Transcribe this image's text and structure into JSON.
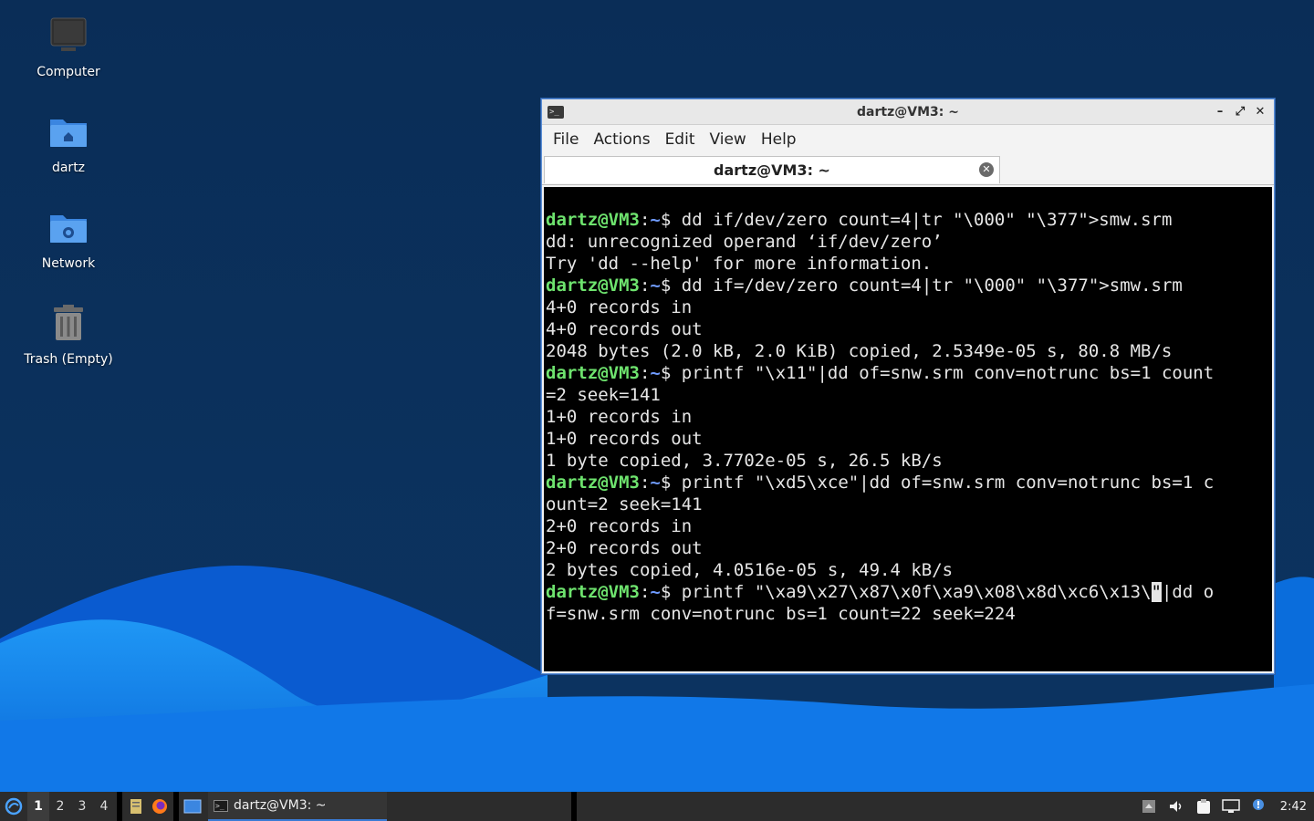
{
  "desktop": {
    "icons": [
      {
        "label": "Computer"
      },
      {
        "label": "dartz"
      },
      {
        "label": "Network"
      },
      {
        "label": "Trash (Empty)"
      }
    ]
  },
  "terminal": {
    "title": "dartz@VM3: ~",
    "menu": [
      "File",
      "Actions",
      "Edit",
      "View",
      "Help"
    ],
    "tab_label": "dartz@VM3: ~",
    "prompt_user": "dartz@VM3",
    "prompt_path": "~",
    "lines": [
      {
        "type": "cmd",
        "text": " dd if/dev/zero count=4|tr \"\\000\" \"\\377\">smw.srm"
      },
      {
        "type": "out",
        "text": "dd: unrecognized operand ‘if/dev/zero’"
      },
      {
        "type": "out",
        "text": "Try 'dd --help' for more information."
      },
      {
        "type": "cmd",
        "text": " dd if=/dev/zero count=4|tr \"\\000\" \"\\377\">smw.srm"
      },
      {
        "type": "out",
        "text": "4+0 records in"
      },
      {
        "type": "out",
        "text": "4+0 records out"
      },
      {
        "type": "out",
        "text": "2048 bytes (2.0 kB, 2.0 KiB) copied, 2.5349e-05 s, 80.8 MB/s"
      },
      {
        "type": "cmd",
        "text": " printf \"\\x11\"|dd of=snw.srm conv=notrunc bs=1 count"
      },
      {
        "type": "out",
        "text": "=2 seek=141"
      },
      {
        "type": "out",
        "text": "1+0 records in"
      },
      {
        "type": "out",
        "text": "1+0 records out"
      },
      {
        "type": "out",
        "text": "1 byte copied, 3.7702e-05 s, 26.5 kB/s"
      },
      {
        "type": "cmd",
        "text": " printf \"\\xd5\\xce\"|dd of=snw.srm conv=notrunc bs=1 c"
      },
      {
        "type": "out",
        "text": "ount=2 seek=141"
      },
      {
        "type": "out",
        "text": "2+0 records in"
      },
      {
        "type": "out",
        "text": "2+0 records out"
      },
      {
        "type": "out",
        "text": "2 bytes copied, 4.0516e-05 s, 49.4 kB/s"
      },
      {
        "type": "cmd_cursor",
        "before": " printf \"\\xa9\\x27\\x87\\x0f\\xa9\\x08\\x8d\\xc6\\x13\\",
        "cursor": "\"",
        "after": "|dd o"
      },
      {
        "type": "out",
        "text": "f=snw.srm conv=notrunc bs=1 count=22 seek=224"
      }
    ]
  },
  "taskbar": {
    "workspaces": [
      "1",
      "2",
      "3",
      "4"
    ],
    "active_workspace": "1",
    "task_label": "dartz@VM3: ~",
    "clock": "2:42"
  },
  "colors": {
    "desktop_dark": "#0b2c55",
    "wave_light": "#1a8df0",
    "wave_dark": "#0a5bd0",
    "prompt_green": "#6ee36e",
    "path_blue": "#6f9bff"
  }
}
